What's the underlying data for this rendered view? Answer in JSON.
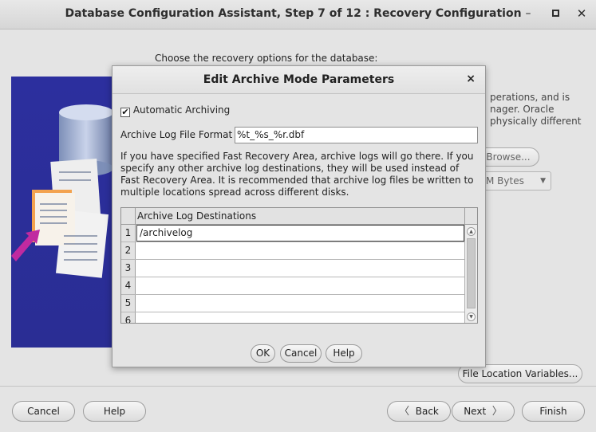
{
  "window": {
    "title": "Database Configuration Assistant, Step 7 of 12 : Recovery Configuration",
    "minimize_glyph": "–",
    "close_glyph": "✕"
  },
  "main": {
    "intro": "Choose the recovery options for the database:",
    "bg_text_lines": [
      "perations, and is",
      "nager. Oracle",
      "physically different"
    ],
    "browse_label": "Browse...",
    "size_unit": "M Bytes",
    "file_location_variables_label": "File Location Variables..."
  },
  "footer": {
    "cancel": "Cancel",
    "help": "Help",
    "back": "Back",
    "next": "Next",
    "finish": "Finish",
    "back_chevron": "〈",
    "next_chevron": "〉"
  },
  "dialog": {
    "title": "Edit Archive Mode Parameters",
    "close_glyph": "×",
    "automatic_archiving_label": "Automatic Archiving",
    "automatic_archiving_checked": true,
    "check_glyph": "✔",
    "format_label": "Archive Log File Format",
    "format_value": "%t_%s_%r.dbf",
    "info": "If you have specified Fast Recovery Area, archive logs will go there. If you specify any other archive log destinations, they will be used instead of Fast Recovery Area. It is recommended that archive log files be written to multiple locations spread across different disks.",
    "table": {
      "column_header": "Archive Log Destinations",
      "rows": [
        {
          "num": "1",
          "value": "/archivelog"
        },
        {
          "num": "2",
          "value": ""
        },
        {
          "num": "3",
          "value": ""
        },
        {
          "num": "4",
          "value": ""
        },
        {
          "num": "5",
          "value": ""
        },
        {
          "num": "6",
          "value": ""
        }
      ]
    },
    "buttons": {
      "ok": "OK",
      "cancel": "Cancel",
      "help": "Help"
    }
  }
}
